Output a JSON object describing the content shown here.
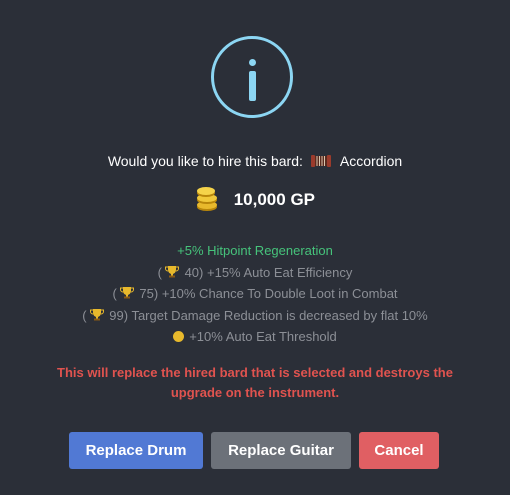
{
  "dialog": {
    "icon": "info-icon",
    "question": "Would you like to hire this bard:",
    "bard_icon": "accordion-icon",
    "bard_name": "Accordion",
    "cost_icon": "gp-coins-icon",
    "cost": "10,000 GP",
    "modifiers": {
      "primary": "+5% Hitpoint Regeneration",
      "tier1": {
        "open": "(",
        "icon": "trophy-icon",
        "level": "40)",
        "text": "+15% Auto Eat Efficiency"
      },
      "tier2": {
        "open": "(",
        "icon": "trophy-icon",
        "level": "75)",
        "text": "+10% Chance To Double Loot in Combat"
      },
      "tier3": {
        "open": "(",
        "icon": "trophy-icon",
        "level": "99)",
        "text": "Target Damage Reduction is decreased by flat 10%"
      },
      "tier4": {
        "icon": "gp-icon",
        "text": "+10% Auto Eat Threshold"
      }
    },
    "warning": "This will replace the hired bard that is selected and destroys the upgrade on the instrument.",
    "buttons": {
      "replace_drum": "Replace Drum",
      "replace_guitar": "Replace Guitar",
      "cancel": "Cancel"
    },
    "colors": {
      "background": "#2b2f38",
      "info": "#8cd6f3",
      "positive": "#46c37b",
      "muted": "#8c8f96",
      "danger": "#e0534f",
      "primary_button": "#5179d4",
      "secondary_button": "#6c7179",
      "cancel_button": "#e05f63"
    }
  }
}
